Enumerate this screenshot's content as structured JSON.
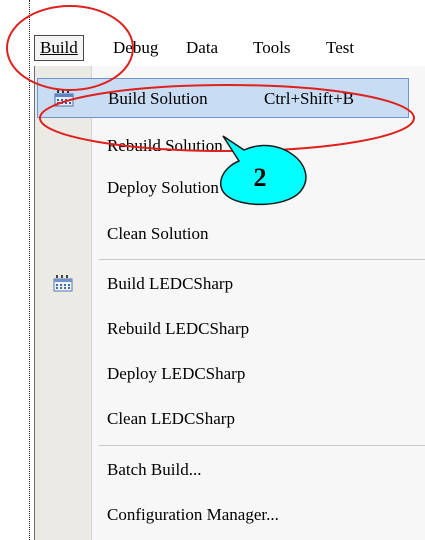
{
  "menubar": {
    "items": [
      {
        "label": "Build",
        "active": true
      },
      {
        "label": "Debug"
      },
      {
        "label": "Data"
      },
      {
        "label": "Tools"
      },
      {
        "label": "Test"
      }
    ]
  },
  "dropdown": {
    "items": [
      {
        "label": "Build Solution",
        "shortcut": "Ctrl+Shift+B",
        "icon": "build-icon",
        "highlighted": true
      },
      {
        "label": "Rebuild Solution"
      },
      {
        "label": "Deploy Solution"
      },
      {
        "label": "Clean Solution"
      },
      {
        "label": "Build LEDCSharp",
        "icon": "build-icon"
      },
      {
        "label": "Rebuild LEDCSharp"
      },
      {
        "label": "Deploy LEDCSharp"
      },
      {
        "label": "Clean LEDCSharp"
      },
      {
        "label": "Batch Build..."
      },
      {
        "label": "Configuration Manager..."
      }
    ]
  },
  "annotation": {
    "step_number": "2",
    "circle_color": "#e0201c",
    "callout_fill": "#00ffff"
  }
}
